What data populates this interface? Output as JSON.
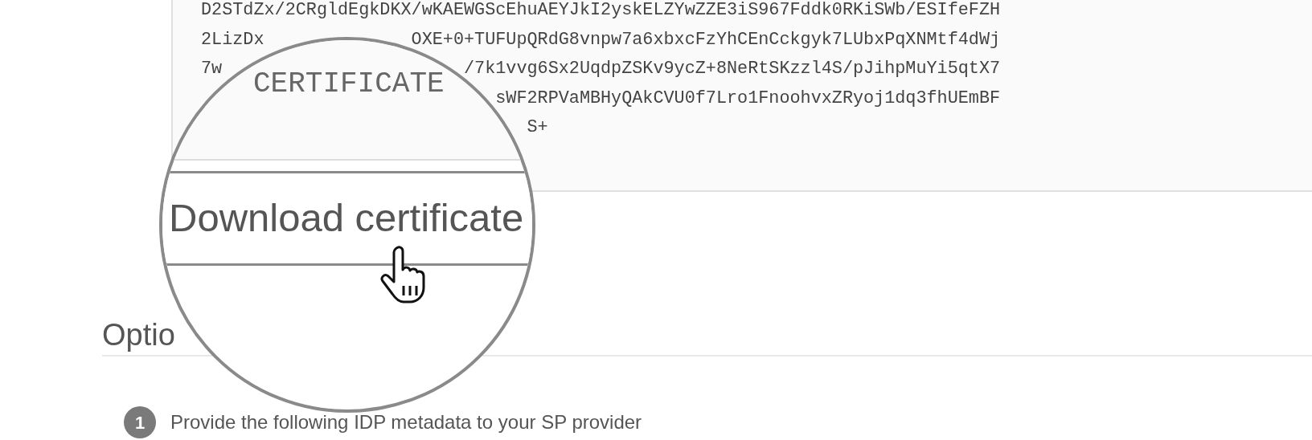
{
  "certificate": {
    "lines": [
      {
        "segments": [
          "D2STdZx/2CRgldEgkDKX/wKAEWGScEhuAEYJkI2yskELZYwZZE3iS967Fddk0RKiSWb/ESIfeFZH"
        ]
      },
      {
        "segments": [
          "2LizDx",
          "OXE+0+TUFUpQRdG8vnpw7a6xbxcFzYhCEnCckgyk7LUbxPqXNMtf4dWj"
        ]
      },
      {
        "segments": [
          "7w",
          "/7k1vvg6Sx2UqdpZSKv9ycZ+8NeRtSKzzl4S/pJihpMuYi5qtX7"
        ]
      },
      {
        "segments": [
          "sWF2RPVaMBHyQAkCVU0f7Lro1FnoohvxZRyoj1dq3fhUEmBF"
        ]
      },
      {
        "segments": [
          "S+"
        ]
      }
    ]
  },
  "magnifier": {
    "certificate_text": "CERTIFICATE",
    "button": "Download certificate"
  },
  "section": {
    "heading": "Optio"
  },
  "steps": [
    {
      "number": "1",
      "text": "Provide the following IDP metadata to your SP provider"
    }
  ]
}
